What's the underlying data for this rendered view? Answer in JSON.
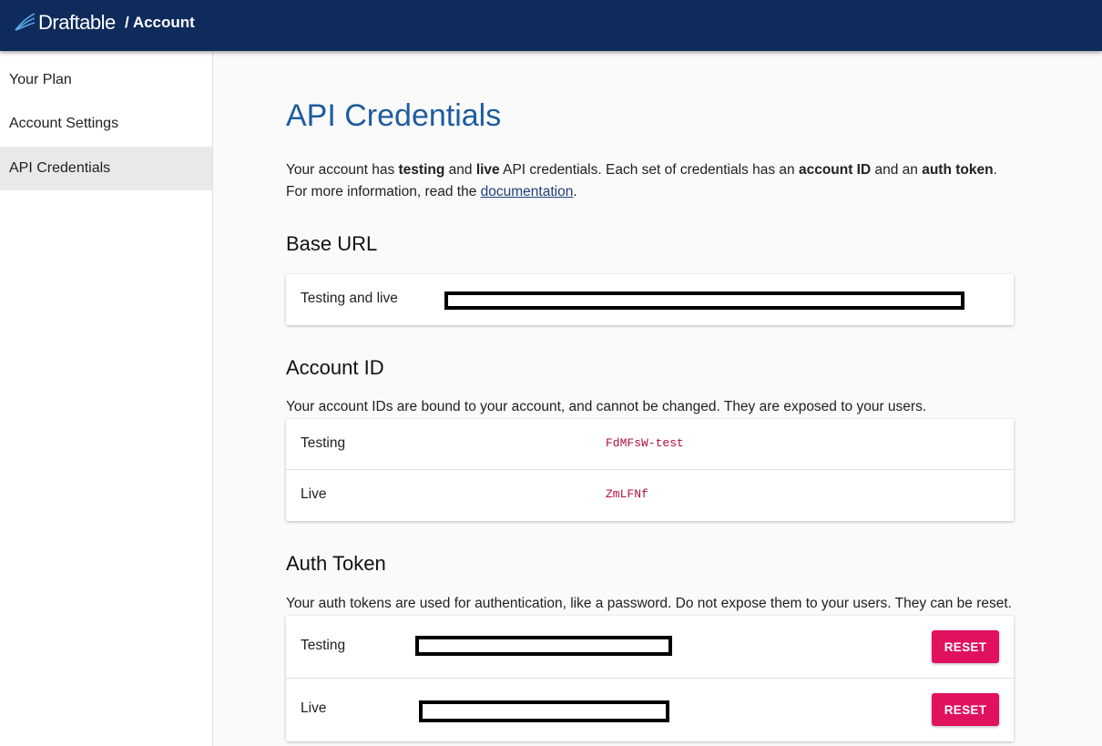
{
  "header": {
    "brand": "Draftable",
    "breadcrumb": "/ Account",
    "logo_icon": "draftable-logo-icon"
  },
  "sidebar": {
    "items": [
      {
        "label": "Your Plan",
        "active": false
      },
      {
        "label": "Account Settings",
        "active": false
      },
      {
        "label": "API Credentials",
        "active": true
      }
    ]
  },
  "main": {
    "title": "API Credentials",
    "intro": {
      "t1": "Your account has ",
      "b1": "testing",
      "t2": " and ",
      "b2": "live",
      "t3": " API credentials. Each set of credentials has an ",
      "b3": "account ID",
      "t4": " and an ",
      "b4": "auth token",
      "t5": ".",
      "t6": "For more information, read the ",
      "link": "documentation",
      "t7": "."
    },
    "base_url": {
      "heading": "Base URL",
      "rows": [
        {
          "label": "Testing and live",
          "redacted": true
        }
      ]
    },
    "account_id": {
      "heading": "Account ID",
      "description": "Your account IDs are bound to your account, and cannot be changed. They are exposed to your users.",
      "rows": [
        {
          "label": "Testing",
          "value": "FdMFsW-test"
        },
        {
          "label": "Live",
          "value": "ZmLFNf"
        }
      ]
    },
    "auth_token": {
      "heading": "Auth Token",
      "description": "Your auth tokens are used for authentication, like a password. Do not expose them to your users. They can be reset.",
      "rows": [
        {
          "label": "Testing",
          "redacted": true,
          "button": "RESET"
        },
        {
          "label": "Live",
          "redacted": true,
          "button": "RESET"
        }
      ]
    }
  },
  "colors": {
    "header_bg": "#0f2b5b",
    "title": "#1f5c9e",
    "code": "#b0103a",
    "reset_button": "#e0115f"
  }
}
